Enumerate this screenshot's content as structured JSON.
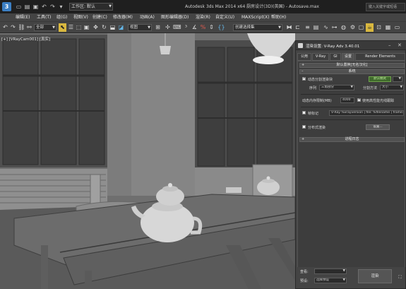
{
  "titlebar": {
    "workspace_label": "工作区: 默认",
    "app_title": "Autodesk 3ds Max 2014 x64     厨房设计(3D)(英国) - Autosave.max",
    "search_placeholder": "键入关键字或短语"
  },
  "menu": [
    "编辑(E)",
    "工具(T)",
    "组(G)",
    "视图(V)",
    "创建(C)",
    "修改器(M)",
    "动画(A)",
    "图形编辑器(D)",
    "渲染(R)",
    "自定义(U)",
    "MAXScript(X)",
    "帮助(H)"
  ],
  "toolbar": {
    "filter_dropdown": "全部",
    "refcoord_dropdown": "视图",
    "selection_set_placeholder": "创建选择集"
  },
  "viewport": {
    "label": "[+] [VRayCam001] [真实]"
  },
  "dialog": {
    "title": "渲染设置: V-Ray Adv 3.40.01",
    "tabs": [
      "公用",
      "V-Ray",
      "GI",
      "设置",
      "Render Elements"
    ],
    "active_tab": "设置",
    "rollout_default_displacement": "默认置换[无名汉化]",
    "rollout_system": "系统",
    "dynamic_split": "动态分割渲染块",
    "default_mode_button": "默认模式",
    "sequence_label": "序列",
    "sequence_value": "三角剖分",
    "split_method_label": "分割方法",
    "split_method_value": "大小",
    "dynamic_memory_label": "动态内存限制(MB)",
    "dynamic_memory_value": "4000",
    "use_high_perf_label": "使用高性能光线跟踪",
    "frame_stamp_label": "帧标记",
    "frame_stamp_value": "V-Ray %vrayversion | file: %filename | frame: %frame | ...",
    "distributed_render_label": "分布式渲染",
    "settings_button": "设置...",
    "rollout_log": "进程日志",
    "view_label": "查看:",
    "preset_label": "预设:",
    "preset_value": "选择预设",
    "render_button": "渲染"
  }
}
